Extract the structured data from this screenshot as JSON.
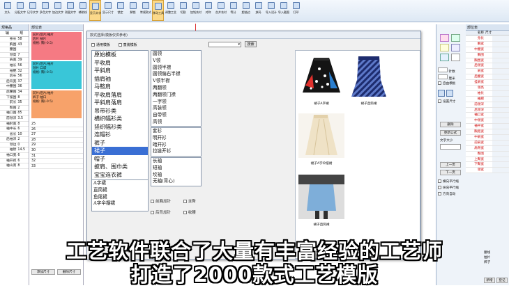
{
  "toolbar": {
    "items": [
      "文头",
      "分配文字",
      "记号文字",
      "多色文字",
      "加边文字",
      "测量文字",
      "辅助线",
      "显示文字",
      "显示尺寸",
      "锁定",
      "解锁",
      "常规款式",
      "移动工具",
      "调整工艺",
      "切割",
      "加钱衣衬",
      "对称",
      "合并衣衬",
      "等分",
      "超抽边",
      "放码",
      "导入设计",
      "导入截图",
      "打印"
    ],
    "highlighted": [
      7,
      12
    ]
  },
  "left_panel": {
    "header": "规格品",
    "tabs": [
      "辅",
      "规"
    ],
    "rows": [
      {
        "name": "身长",
        "value": "58"
      },
      {
        "name": "胸围",
        "value": "43"
      },
      {
        "name": "腰围",
        "value": ""
      },
      {
        "name": "领高",
        "value": "7"
      },
      {
        "name": "肩宽",
        "value": "39"
      },
      {
        "name": "袖长",
        "value": "56"
      },
      {
        "name": "袖肥",
        "value": "32"
      },
      {
        "name": "后长",
        "value": "56"
      },
      {
        "name": "后背宽",
        "value": "37"
      },
      {
        "name": "中腰围",
        "value": "36"
      },
      {
        "name": "后腰围",
        "value": "34"
      },
      {
        "name": "下摆围",
        "value": "8"
      },
      {
        "name": "前长",
        "value": "35"
      },
      {
        "name": "臀围",
        "value": "2"
      },
      {
        "name": "袖口围",
        "value": "85"
      },
      {
        "name": "前领深",
        "value": "3.5"
      },
      {
        "name": "袖肘宽",
        "value": "8"
      },
      {
        "name": "袖中长",
        "value": "6"
      },
      {
        "name": "省长",
        "value": "10"
      },
      {
        "name": "后袖深",
        "value": "2"
      },
      {
        "name": "领边",
        "value": "0"
      },
      {
        "name": "袖肘",
        "value": "14.5"
      },
      {
        "name": "袖口宽",
        "value": "6"
      },
      {
        "name": "袖开衩",
        "value": "6"
      },
      {
        "name": "袖山高",
        "value": "8"
      }
    ]
  },
  "middle_panel": {
    "header": "部位表",
    "blocks": [
      {
        "title": "前片/后片/袖片",
        "line1": "后片 袖片",
        "line2": "规格: 胸(-0.5)",
        "color": "#f57a83"
      },
      {
        "title": "前片/后片/袖片",
        "line1": "领片 口袋",
        "line2": "规格: 胸(-0.5)",
        "color": "#39c6d8"
      },
      {
        "title": "前片/后片/袖片",
        "line1": "裤子 袖口",
        "line2": "规格: 胸(-0.5)",
        "color": "#f7a26a"
      }
    ],
    "sizes": [
      "25",
      "26",
      "27",
      "28",
      "29",
      "30",
      "31",
      "32",
      "33"
    ],
    "footer_buttons": [
      "添加尺寸",
      "删除尺寸"
    ]
  },
  "dialog": {
    "title": "款式选择(模板仅供参考)",
    "option1": "通用模板",
    "option2": "童装模板",
    "search_button": "搜索",
    "categories": [
      "原始模板",
      "平收肩",
      "平斜肩",
      "插肩袖",
      "马鞍肩",
      "平收肩落肩",
      "平斜肩落肩",
      "吊带衫类",
      "横织幅衫类",
      "竖织幅衫类",
      "连帽衫",
      "裤子",
      "裙子",
      "帽子",
      "披肩、围巾类",
      "宝宝连衣裤"
    ],
    "selected_category": 12,
    "skirt_types": [
      "A字裙",
      "直筒裙",
      "鱼尾裙",
      "A字伞摆裙"
    ],
    "necklines": [
      "圆领",
      "V领",
      "圆领半襟",
      "圆领偏右半襟",
      "V领半襟",
      "两翻领",
      "两翻领门襟",
      "一字领",
      "高装领",
      "自带领",
      "高领"
    ],
    "cardigans": [
      "套衫",
      "明开衫",
      "暗开衫",
      "拉链开衫"
    ],
    "sleeves": [
      "长袖",
      "短袖",
      "坎袖",
      "无袖(背心)"
    ],
    "checkboxes": [
      "前胸加针",
      "含臀",
      "后背加针",
      "收腰"
    ],
    "thumbnails": [
      {
        "caption": "裙子A字裙"
      },
      {
        "caption": "裙子直筒裙"
      },
      {
        "caption": "裙子A字伞摆裙"
      },
      {
        "caption": "裙子直筒裙"
      }
    ]
  },
  "right_panel": {
    "header": "部位表",
    "columns": [
      "名称",
      "尺寸"
    ],
    "rows": [
      "身长",
      "胸宽",
      "中腰宽",
      "胸围",
      "胸围宽",
      "后领宽",
      "肩宽",
      "后腰宽",
      "挂肩宽",
      "领高",
      "袖长",
      "袖肥",
      "前领深",
      "后领深",
      "袖口宽",
      "中领宽",
      "袖中宽",
      "胸宽宽",
      "中肩宽",
      "前肩宽",
      "肩骨宽",
      "臀围",
      "上臀宽",
      "下臀宽",
      "领宽"
    ],
    "buttons": [
      "删除",
      "更新公式",
      "上一页",
      "下一页",
      "新增",
      "登记"
    ],
    "labels": [
      "针数",
      "厘米",
      "自由模板",
      "设置尺寸",
      "文字大小",
      "横向平行缩",
      "纵向平行缩",
      "方向自动"
    ],
    "small_text": [
      "腰线",
      "抽片",
      "裤子"
    ]
  },
  "subtitle": {
    "line1": "工艺软件联合了大量有丰富经验的工艺师",
    "line2": "打造了2000款式工艺模版"
  },
  "colors": {
    "selection": "#3a6fd4",
    "toolbar_bg": "#dde8f4",
    "highlight": "#fbd98a"
  }
}
